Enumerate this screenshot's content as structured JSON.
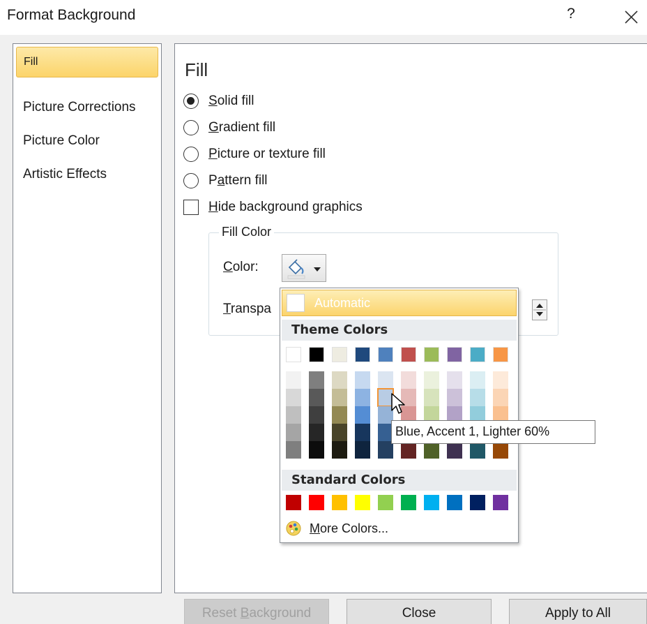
{
  "window": {
    "title": "Format Background",
    "help": "?"
  },
  "nav": {
    "items": [
      {
        "label": "Fill",
        "selected": true
      },
      {
        "label": "Picture Corrections",
        "selected": false
      },
      {
        "label": "Picture Color",
        "selected": false
      },
      {
        "label": "Artistic Effects",
        "selected": false
      }
    ]
  },
  "fill": {
    "section_title": "Fill",
    "options": [
      {
        "accel": "S",
        "rest": "olid fill",
        "selected": true
      },
      {
        "accel": "G",
        "rest": "radient fill",
        "selected": false
      },
      {
        "accel": "P",
        "rest": "icture or texture fill",
        "selected": false
      },
      {
        "pre": "P",
        "accel": "a",
        "rest": "ttern fill",
        "selected": false
      }
    ],
    "hide_bg": {
      "accel": "H",
      "rest": "ide background graphics",
      "checked": false
    },
    "fill_color": {
      "legend": "Fill Color",
      "color_label_accel": "C",
      "color_label_rest": "olor:",
      "transparency_accel": "T",
      "transparency_rest": "ranspa"
    }
  },
  "color_picker": {
    "automatic": "Automatic",
    "theme_heading": "Theme Colors",
    "standard_heading": "Standard Colors",
    "more_accel": "M",
    "more_rest": "ore Colors...",
    "theme_top": [
      "#ffffff",
      "#000000",
      "#eeece1",
      "#1f497d",
      "#4f81bd",
      "#c0504d",
      "#9bbb59",
      "#8064a2",
      "#4bacc6",
      "#f79646"
    ],
    "theme_shades": [
      [
        "#f2f2f2",
        "#d8d8d8",
        "#bfbfbf",
        "#a5a5a5",
        "#7f7f7f"
      ],
      [
        "#7f7f7f",
        "#595959",
        "#3f3f3f",
        "#262626",
        "#0c0c0c"
      ],
      [
        "#ddd9c3",
        "#c4bd97",
        "#938953",
        "#494429",
        "#1d1b10"
      ],
      [
        "#c6d9f0",
        "#8db3e2",
        "#548dd4",
        "#17365d",
        "#0f243e"
      ],
      [
        "#dbe5f1",
        "#b8cce4",
        "#95b3d7",
        "#366092",
        "#244061"
      ],
      [
        "#f2dcdb",
        "#e5b9b7",
        "#d99694",
        "#953734",
        "#632423"
      ],
      [
        "#ebf1dd",
        "#d7e3bc",
        "#c3d69b",
        "#76923c",
        "#4f6128"
      ],
      [
        "#e5e0ec",
        "#ccc1d9",
        "#b2a2c7",
        "#5f497a",
        "#3f3151"
      ],
      [
        "#dbeef3",
        "#b7dde8",
        "#92cddc",
        "#31859b",
        "#205867"
      ],
      [
        "#fdeada",
        "#fbd5b5",
        "#fac08f",
        "#e36c09",
        "#974806"
      ]
    ],
    "standard": [
      "#c00000",
      "#ff0000",
      "#ffc000",
      "#ffff00",
      "#92d050",
      "#00b050",
      "#00b0f0",
      "#0070c0",
      "#002060",
      "#7030a0"
    ],
    "tooltip": "Blue, Accent 1, Lighter 60%"
  },
  "buttons": {
    "reset": {
      "pre": "Reset ",
      "accel": "B",
      "rest": "ackground"
    },
    "close": "Close",
    "apply_all": "Apply to All"
  }
}
